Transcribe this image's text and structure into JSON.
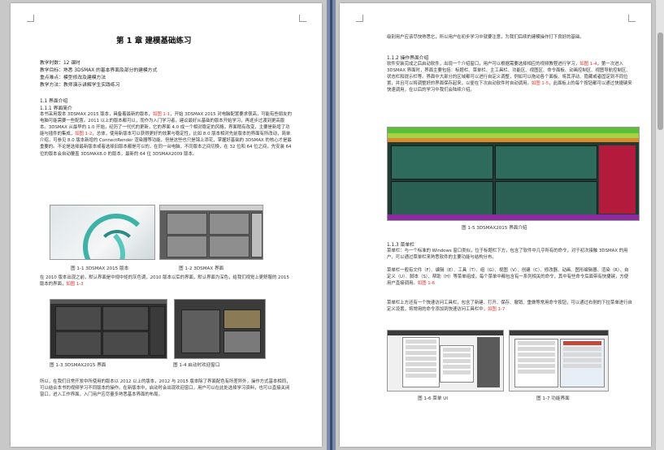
{
  "left": {
    "chapter_title": "第 1 章   建模基础练习",
    "meta": [
      "教学时数：12 课时",
      "教学目标：熟悉 3DSMAX 的基本界面及部分的建模方式",
      "重点难点：模型修改及建模方法",
      "教学方法：教师演示讲解学生实践练习"
    ],
    "sec_1_1": "1.1 界面介绍",
    "sec_1_1_1": "1.1.1 界面简介",
    "para1_a": "本书采用版本 3DSMAX 2015 版本，具备着最新的版本，",
    "para1_ref1": "如图 1-1",
    "para1_b": "，开始 3DSMAX 2015 对电脑配置要求很高，可能有些朋友的电脑可能需要一些配置。2011 以上的版本都可以，而作为入门学习者，建议最好从基础的版本开始学习，再逐步过渡到更高版本。3DSMAX 从最早的 1.0 开始，经历了一代代的更新，它的界面 4.0 成一个相对稳定的风格，界面稍有改变，主要是新增了功能与插件的集成，",
    "para1_ref2": "如图 1-2",
    "para1_c": "，总体，使用新版本可以获得更好的效果与稳定性，比如 8.0 版本相对先前版本的界面有所改动，简单介绍，可参见 8.0 版本新增的 ConnectRender 渲染器等功能，但是这些也只是锦上添花，掌握好基础的 3DSMAX 的核心才是最重要的。不论是选择最新版本或者选择旧版本都是可以的，在同一台电脑，不同版本之间切换，在 32 位和 64 位之间，先安装 64 位的版本会自动覆盖 3DSMAX8.0 的版本，最新的 64 位 3DSMAX2009 版本。",
    "fig1_1_cap": "图 1-1 3DSMAX 2015 版本",
    "fig1_2_cap": "图 1-2 3DSMAX 界面",
    "para2_a": "在 2010 版本出现之前，默认界面是中规中矩的灰色调，2010 版本以后的界面，默认界面为深色，给我们视觉上更舒服的 2015 版本的界面，",
    "para2_ref": "如图 1-3",
    "fig1_3_cap": "图 1-3 3DSMAX2015 界面",
    "fig1_4_cap": "图 1-4 启动时欢迎窗口",
    "para3": "所以，在我们日常开发中所使用的版本以 2012 以上的版本，2012 与 2015 版本除了界面配色有所差异外，操作方式基本相同，可以结合本书的视频学习不同版本的操作。在新版本中，启动时会出现欢迎窗口，用户可以在此处选择学习资料，也可以直接关闭窗口，进入工作界面，入门用户应尽量多熟悉基本界面的布局。"
  },
  "right": {
    "top_para": "级别用户应该尽快熟悉它，所以用户在初步学习中就要注意，为我们后续的建模操作打下良好的基础。",
    "sec_1_1_2": "1.1.2 操作界面介绍",
    "para1_a": "软件安装完成之后启动软件，出现一个介绍窗口，用户可以根据需要选择相应的视频教程进行学习，",
    "para1_ref1": "如图 1-4",
    "para1_b": "，第一次进入 3DSMAX 界面时，界面主要包括：标题栏、菜单栏、主工具栏、功能区、视图区、命令面板、动画控制区、视图导航控制区、状态栏和提示栏等。界面中大部分的区域都可以进行自定义调整，例如可以拖动各个面板、将其浮动、隐藏或者固定到不同位置，并且可以将调整好的界面保存起来，以便在下次启动软件时自动调用。",
    "para1_ref2": "如图 1-5",
    "para1_c": "，此面板上的每个按钮都可以通过快捷键来快速调用，在以后的学习中我们会陆续介绍。",
    "fig1_5_cap": "图 1-5 3DSMAX2015 界面介绍",
    "sec_1_1_3": "1.1.3 菜单栏",
    "para2_a": "菜单栏：与一个标准的 Windows 窗口类似，位于标题栏下方，包含了软件中几乎所有的命令，对于初次接触 3DSMAX 的用户，可以通过菜单栏来熟悉软件的主要功能与结构分布。",
    "para2_b": "菜单栏一般有文件（F）、编辑（E）、工具（T）、组（G）、视图（V）、创建（C）、修改器、动画、图形编辑器、渲染（R）、自定义（U）、脚本（S）、帮助（H）等菜单组成，每个菜单中都包含有一系列相关的命令，其中有些命令后面带有快捷键，方便用户直接调用。",
    "para2_ref1": "如图 1-6",
    "para2_c": "菜单栏上方还有一个快速访问工具栏，包含了新建、打开、保存、撤销、重做等常用命令按钮，可以通过右侧的下拉菜单进行自定义设置，将常用的命令添加到快速访问工具栏中，",
    "para2_ref2": "如图 1-7",
    "fig1_6_cap": "图 1-6 菜单 UI",
    "fig1_7_cap": "图 1-7 功能界面"
  }
}
